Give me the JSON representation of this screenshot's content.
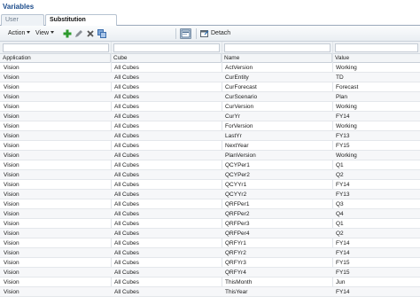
{
  "page": {
    "title": "Variables"
  },
  "tabs": [
    {
      "label": "User Variables",
      "active": false
    },
    {
      "label": "Substitution Variables",
      "active": true
    }
  ],
  "toolbar": {
    "action_label": "Action",
    "view_label": "View",
    "detach_label": "Detach",
    "icons": [
      "add-icon",
      "edit-icon",
      "delete-icon",
      "copy-icon",
      "query-by-example-icon",
      "detach-icon"
    ]
  },
  "columns": [
    "Application",
    "Cube",
    "Name",
    "Value"
  ],
  "rows": [
    {
      "application": "Vision",
      "cube": "All Cubes",
      "name": "ActVersion",
      "value": "Working"
    },
    {
      "application": "Vision",
      "cube": "All Cubes",
      "name": "CurEntity",
      "value": "TD"
    },
    {
      "application": "Vision",
      "cube": "All Cubes",
      "name": "CurForecast",
      "value": "Forecast"
    },
    {
      "application": "Vision",
      "cube": "All Cubes",
      "name": "CurScenario",
      "value": "Plan"
    },
    {
      "application": "Vision",
      "cube": "All Cubes",
      "name": "CurVersion",
      "value": "Working"
    },
    {
      "application": "Vision",
      "cube": "All Cubes",
      "name": "CurYr",
      "value": "FY14"
    },
    {
      "application": "Vision",
      "cube": "All Cubes",
      "name": "ForVersion",
      "value": "Working"
    },
    {
      "application": "Vision",
      "cube": "All Cubes",
      "name": "LastYr",
      "value": "FY13"
    },
    {
      "application": "Vision",
      "cube": "All Cubes",
      "name": "NextYear",
      "value": "FY15"
    },
    {
      "application": "Vision",
      "cube": "All Cubes",
      "name": "PlanVersion",
      "value": "Working"
    },
    {
      "application": "Vision",
      "cube": "All Cubes",
      "name": "QCYPer1",
      "value": "Q1"
    },
    {
      "application": "Vision",
      "cube": "All Cubes",
      "name": "QCYPer2",
      "value": "Q2"
    },
    {
      "application": "Vision",
      "cube": "All Cubes",
      "name": "QCYYr1",
      "value": "FY14"
    },
    {
      "application": "Vision",
      "cube": "All Cubes",
      "name": "QCYYr2",
      "value": "FY13"
    },
    {
      "application": "Vision",
      "cube": "All Cubes",
      "name": "QRFPer1",
      "value": "Q3"
    },
    {
      "application": "Vision",
      "cube": "All Cubes",
      "name": "QRFPer2",
      "value": "Q4"
    },
    {
      "application": "Vision",
      "cube": "All Cubes",
      "name": "QRFPer3",
      "value": "Q1"
    },
    {
      "application": "Vision",
      "cube": "All Cubes",
      "name": "QRFPer4",
      "value": "Q2"
    },
    {
      "application": "Vision",
      "cube": "All Cubes",
      "name": "QRFYr1",
      "value": "FY14"
    },
    {
      "application": "Vision",
      "cube": "All Cubes",
      "name": "QRFYr2",
      "value": "FY14"
    },
    {
      "application": "Vision",
      "cube": "All Cubes",
      "name": "QRFYr3",
      "value": "FY15"
    },
    {
      "application": "Vision",
      "cube": "All Cubes",
      "name": "QRFYr4",
      "value": "FY15"
    },
    {
      "application": "Vision",
      "cube": "All Cubes",
      "name": "ThisMonth",
      "value": "Jun"
    },
    {
      "application": "Vision",
      "cube": "All Cubes",
      "name": "ThisYear",
      "value": "FY14"
    }
  ],
  "colors": {
    "title": "#1a4a8a",
    "add_icon": "#2e9a2e"
  }
}
